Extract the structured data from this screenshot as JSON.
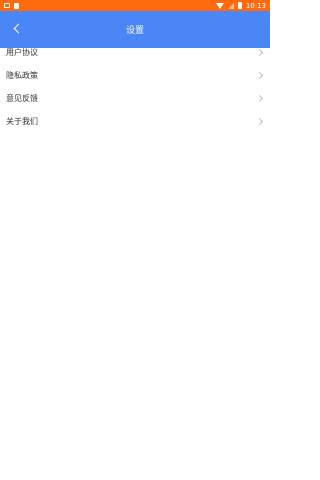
{
  "colors": {
    "status_bar_bg": "#ff6a0f",
    "header_bg": "#4a86f5",
    "text": "#333333",
    "chevron": "#bdbdbd"
  },
  "status_bar": {
    "time": "10:13",
    "left_icons": [
      "image-icon",
      "document-icon"
    ],
    "right_icons": [
      "wifi-icon",
      "signal-icon",
      "battery-icon"
    ]
  },
  "header": {
    "title": "设置",
    "back_icon": "chevron-left-icon"
  },
  "menu": {
    "items": [
      {
        "label": "用户协议"
      },
      {
        "label": "隐私政策"
      },
      {
        "label": "意见反馈"
      },
      {
        "label": "关于我们"
      }
    ]
  }
}
